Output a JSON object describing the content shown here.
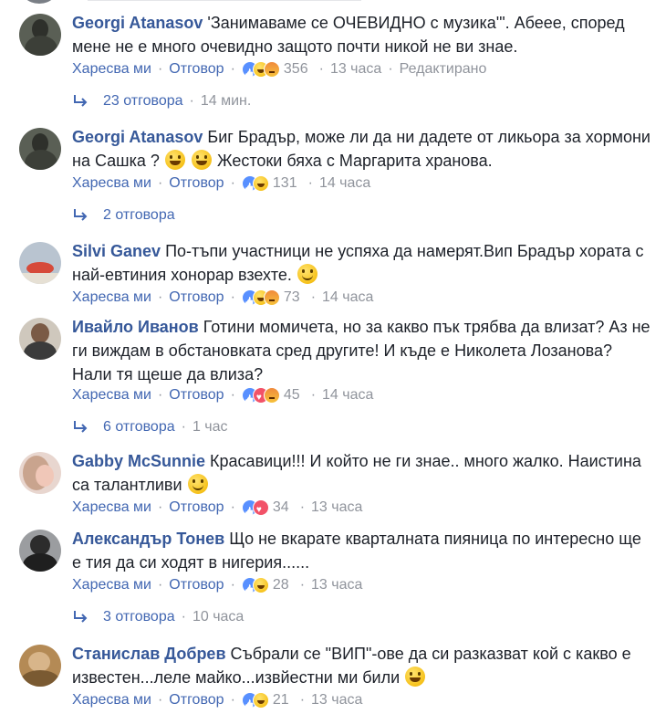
{
  "comments": [
    {
      "author": "Georgi Atanasov",
      "text": "'Занимаваме се ОЧЕВИДНО с музика'\". Абеее, според мене не е много очевидно защото почти никой не ви знае.",
      "emoji": [],
      "like": "Харесва ми",
      "reply": "Отговор",
      "reactions": [
        "like",
        "haha",
        "angry"
      ],
      "count": "356",
      "time": "13 часа",
      "extra": "Редактирано",
      "replies_label": "23 отговора",
      "replies_time": "14 мин."
    },
    {
      "author": "Georgi Atanasov",
      "text_a": "Биг Брадър, може ли да ни дадете от ликьора за хормони на Сашка ?",
      "text_b": "Жестоки бяха с Маргарита хранова.",
      "like": "Харесва ми",
      "reply": "Отговор",
      "reactions": [
        "like",
        "haha"
      ],
      "count": "131",
      "time": "14 часа",
      "replies_label": "2 отговора"
    },
    {
      "author": "Silvi Ganev",
      "text": "По-тъпи участници не успяха да намерят.Вип Брадър хората с най-евтиния хонорар взехте.",
      "like": "Харесва ми",
      "reply": "Отговор",
      "reactions": [
        "like",
        "haha",
        "angry"
      ],
      "count": "73",
      "time": "14 часа"
    },
    {
      "author": "Ивайло Иванов",
      "text": "Готини момичета, но за какво пък трябва да влизат? Аз не ги виждам в обстановката сред другите! И къде е Николета Лозанова? Нали тя щеше да влиза?",
      "like": "Харесва ми",
      "reply": "Отговор",
      "reactions": [
        "like",
        "love",
        "angry"
      ],
      "count": "45",
      "time": "14 часа",
      "replies_label": "6 отговора",
      "replies_time": "1 час"
    },
    {
      "author": "Gabby McSunnie",
      "text": "Красавици!!! И който не ги знае.. много жалко. Наистина са талантливи",
      "like": "Харесва ми",
      "reply": "Отговор",
      "reactions": [
        "like",
        "love"
      ],
      "count": "34",
      "time": "13 часа"
    },
    {
      "author": "Александър Тонев",
      "text": "Що не вкарате кварталната пияница по интересно ще е тия да си ходят в нигерия......",
      "like": "Харесва ми",
      "reply": "Отговор",
      "reactions": [
        "like",
        "haha"
      ],
      "count": "28",
      "time": "13 часа",
      "replies_label": "3 отговора",
      "replies_time": "10 часа"
    },
    {
      "author": "Станислав Добрев",
      "text": "Събрали се \"ВИП\"-ове да си разказват кой с какво е известен...леле майко...извйестни ми били",
      "like": "Харесва ми",
      "reply": "Отговор",
      "reactions": [
        "like",
        "haha"
      ],
      "count": "21",
      "time": "13 часа"
    }
  ],
  "separator": "·",
  "colors": {
    "link": "#365899",
    "action": "#4267b2",
    "meta": "#90949c",
    "text": "#1d2129"
  }
}
